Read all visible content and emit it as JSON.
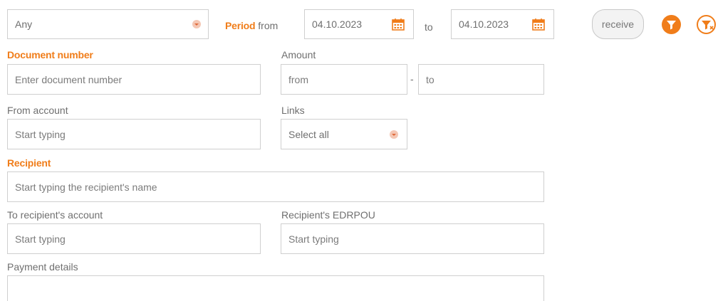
{
  "filters": {
    "type_select": {
      "value": "Any"
    },
    "period": {
      "label_strong": "Period",
      "label_from": "from",
      "label_to": "to",
      "date_from": "04.10.2023",
      "date_to": "04.10.2023"
    },
    "receive_button": "receive",
    "icons": {
      "apply_filter": "filter-icon",
      "clear_filter": "filter-clear-icon",
      "calendar": "calendar-icon"
    }
  },
  "document_number": {
    "label": "Document number",
    "placeholder": "Enter document number"
  },
  "amount": {
    "label": "Amount",
    "from_placeholder": "from",
    "separator": "-",
    "to_placeholder": "to"
  },
  "from_account": {
    "label": "From account",
    "placeholder": "Start typing"
  },
  "links": {
    "label": "Links",
    "value": "Select all"
  },
  "recipient": {
    "label": "Recipient",
    "placeholder": "Start typing the recipient's name"
  },
  "to_recipient_account": {
    "label": "To recipient's account",
    "placeholder": "Start typing"
  },
  "recipient_edrpou": {
    "label": "Recipient's EDRPOU",
    "placeholder": "Start typing"
  },
  "payment_details": {
    "label": "Payment details",
    "value": ""
  },
  "colors": {
    "accent": "#f07d1a",
    "border": "#cfcfcf",
    "text": "#6f6f6f"
  }
}
